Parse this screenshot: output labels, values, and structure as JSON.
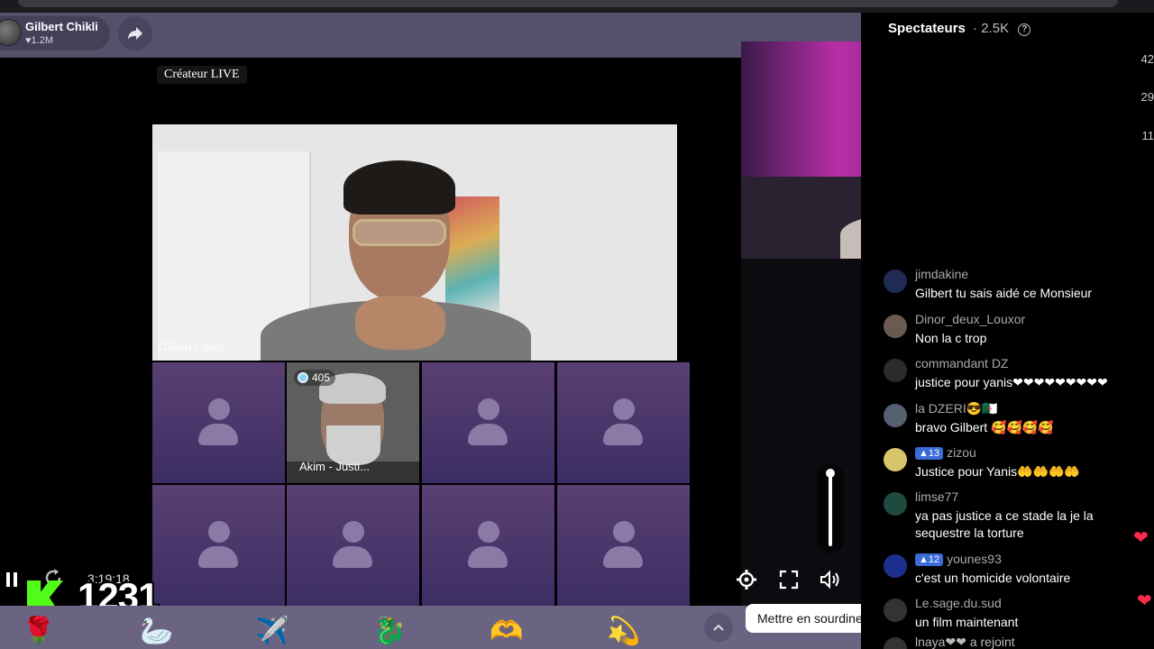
{
  "host": {
    "name": "Gilbert Chikli",
    "likes": "1.2M"
  },
  "video": {
    "creator_badge": "Créateur LIVE",
    "main_camera_label": "Gilbert Chikli",
    "guest": {
      "name": "Akim - Justi...",
      "score": "405"
    }
  },
  "player": {
    "timecode": "3:19:18",
    "counter": "1231",
    "tooltip": "Mettre en sourdine (M)",
    "volume_level": 1.0
  },
  "viewers": {
    "label": "Spectateurs",
    "count": "2.5K",
    "rank_values": [
      "42",
      "29",
      "11"
    ]
  },
  "chat": [
    {
      "user": "jimdakine",
      "text": "Gilbert tu sais aidé ce Monsieur"
    },
    {
      "user": "Dinor_deux_Louxor",
      "text": "Non la c trop"
    },
    {
      "user": "commandant DZ",
      "text": "justice pour yanis❤❤❤❤❤❤❤❤❤"
    },
    {
      "user": "la DZERI😎🇩🇿",
      "text": "bravo Gilbert 🥰🥰🥰🥰"
    },
    {
      "user": "zizou",
      "level": "13",
      "text": "Justice pour Yanis🤲🤲🤲🤲"
    },
    {
      "user": "limse77",
      "text": "ya pas justice a ce stade la je la sequestre la torture"
    },
    {
      "user": "younes93",
      "level": "12",
      "text": "c'est un homicide volontaire"
    },
    {
      "user": "Le.sage.du.sud",
      "text": "un film maintenant"
    },
    {
      "user": "lnaya❤❤",
      "text": "a rejoint"
    }
  ],
  "gifts": [
    "🌹",
    "🦢",
    "✈️",
    "🐉",
    "🫶",
    "💫"
  ],
  "colors": {
    "kick_green": "#53fc18",
    "header_bg": "#56506a",
    "tile_bg": "#4a3468",
    "level_badge": "#3a6bd8"
  }
}
